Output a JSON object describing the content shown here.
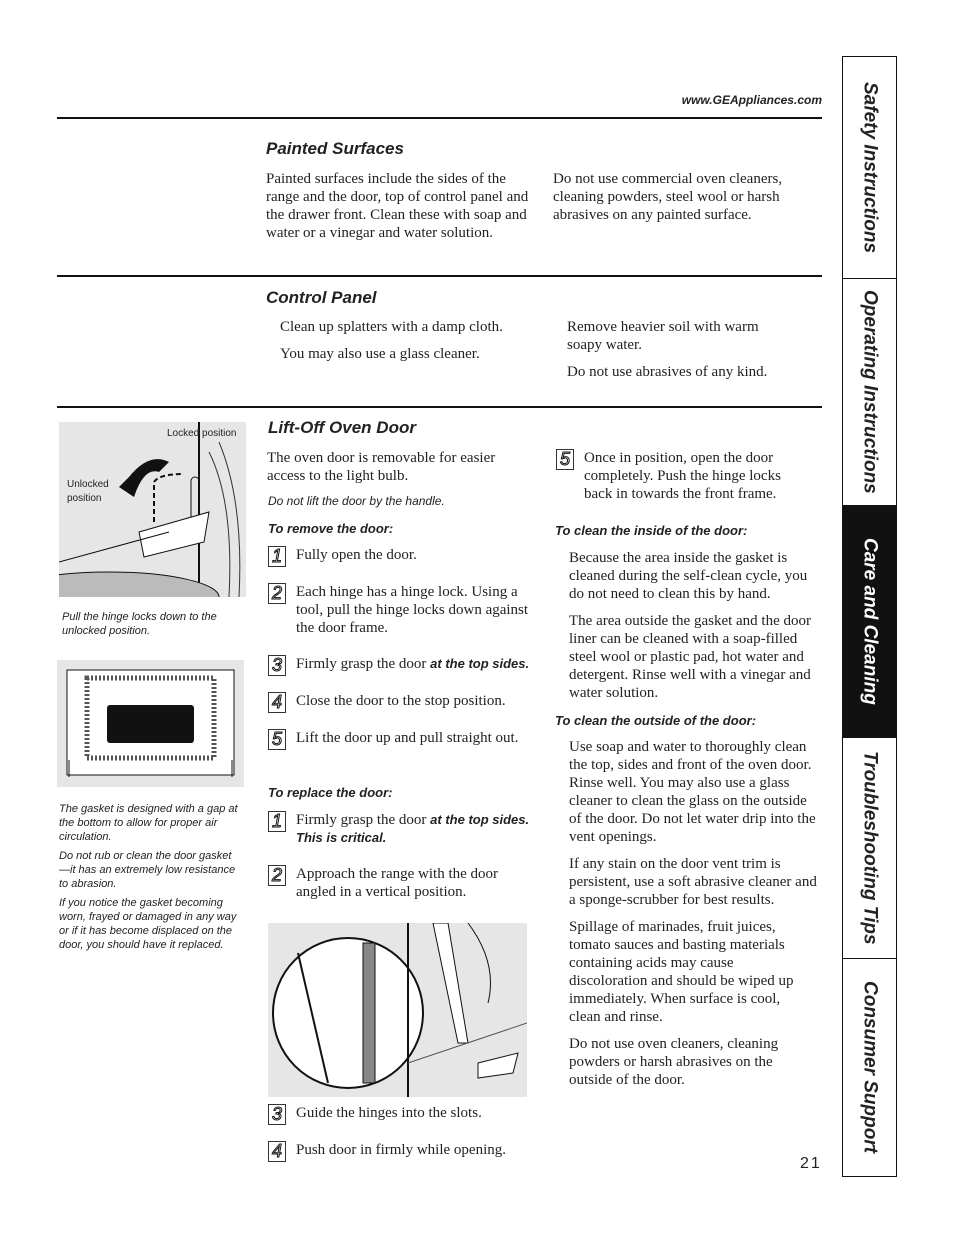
{
  "header": {
    "url": "www.GEAppliances.com"
  },
  "painted": {
    "title": "Painted Surfaces",
    "left": "Painted surfaces include the sides of the range and the door, top of control panel and the drawer front. Clean these with soap and water or a vinegar and water solution.",
    "right": "Do not use commercial oven cleaners, cleaning powders, steel wool or harsh abrasives on any painted surface."
  },
  "control": {
    "title": "Control Panel",
    "left": [
      "Clean up splatters with a damp cloth.",
      "You may also use a glass cleaner."
    ],
    "right": [
      "Remove heavier soil with warm soapy water.",
      "Do not use abrasives of any kind."
    ]
  },
  "door": {
    "title": "Lift-Off Oven Door",
    "intro": "The oven door is removable for easier access to the light bulb.",
    "warning": "Do not lift the door by the handle.",
    "remove_title": "To remove the door:",
    "remove_steps": [
      {
        "n": "1",
        "text": "Fully open the door."
      },
      {
        "n": "2",
        "text": "Each hinge has a hinge lock. Using a tool, pull the hinge locks down against the door frame."
      },
      {
        "n": "3",
        "text": "Firmly grasp the door ",
        "em": "at the top sides."
      },
      {
        "n": "4",
        "text": "Close the door to the stop position."
      },
      {
        "n": "5",
        "text": "Lift the door up and pull straight out."
      }
    ],
    "replace_title": "To replace the door:",
    "replace_steps": [
      {
        "n": "1",
        "text": "Firmly grasp the door ",
        "em": "at the top sides. This is critical."
      },
      {
        "n": "2",
        "text": "Approach the range with the door angled in a vertical position."
      },
      {
        "n": "3",
        "text": "Guide the hinges into the slots."
      },
      {
        "n": "4",
        "text": "Push door in firmly while opening."
      },
      {
        "n": "5",
        "text": "Once in position, open the door completely. Push the hinge locks back in towards the front frame."
      }
    ],
    "inside_title": "To clean the inside of the door:",
    "inside": [
      "Because the area inside the gasket is cleaned during the self-clean cycle, you do not need to clean this by hand.",
      "The area outside the gasket and the door liner can be cleaned with a soap-filled steel wool or plastic pad, hot water and detergent. Rinse well with a vinegar and water solution."
    ],
    "outside_title": "To clean the outside of the door:",
    "outside": [
      "Use soap and water to thoroughly clean the top, sides and front of the oven door. Rinse well. You may also use a glass cleaner to clean the glass on the outside of the door. Do not let water drip into the vent openings.",
      "If any stain on the door vent trim is persistent, use a soft abrasive cleaner and a sponge-scrubber for best results.",
      "Spillage of marinades, fruit juices, tomato sauces and basting materials containing acids may cause discoloration and should be wiped up immediately. When surface is cool, clean and rinse.",
      "Do not use oven cleaners, cleaning powders or harsh abrasives on the outside of the door."
    ]
  },
  "hinge_figure": {
    "locked_label": "Locked position",
    "unlocked_label": "Unlocked position",
    "caption": "Pull the hinge locks down to the unlocked position."
  },
  "gasket_notes": [
    "The gasket is designed with a gap at the bottom to allow for proper air circulation.",
    "Do not rub or clean the door gasket—it has an extremely low resistance to abrasion.",
    "If you notice the gasket becoming worn, frayed or damaged in any way or if it has become displaced on the door, you should have it replaced."
  ],
  "tabs": [
    {
      "label": "Safety Instructions",
      "active": false
    },
    {
      "label": "Operating Instructions",
      "active": false
    },
    {
      "label": "Care and Cleaning",
      "active": true
    },
    {
      "label": "Troubleshooting Tips",
      "active": false
    },
    {
      "label": "Consumer Support",
      "active": false
    }
  ],
  "page_number": "21"
}
